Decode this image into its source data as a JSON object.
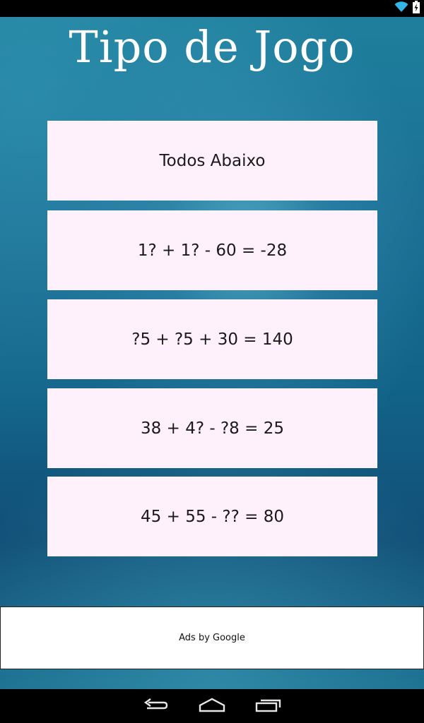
{
  "screen": {
    "title": "Tipo de Jogo"
  },
  "options": [
    {
      "label": "Todos Abaixo"
    },
    {
      "label": "1? + 1? - 60 = -28"
    },
    {
      "label": "?5 + ?5 + 30 = 140"
    },
    {
      "label": "38 + 4? - ?8 = 25"
    },
    {
      "label": "45 + 55 - ?? = 80"
    }
  ],
  "ad": {
    "label": "Ads by Google"
  },
  "status_bar": {
    "icons": [
      "wifi-icon",
      "battery-charging-icon"
    ]
  },
  "nav_bar": {
    "icons": [
      "back-icon",
      "home-icon",
      "recent-apps-icon"
    ]
  }
}
